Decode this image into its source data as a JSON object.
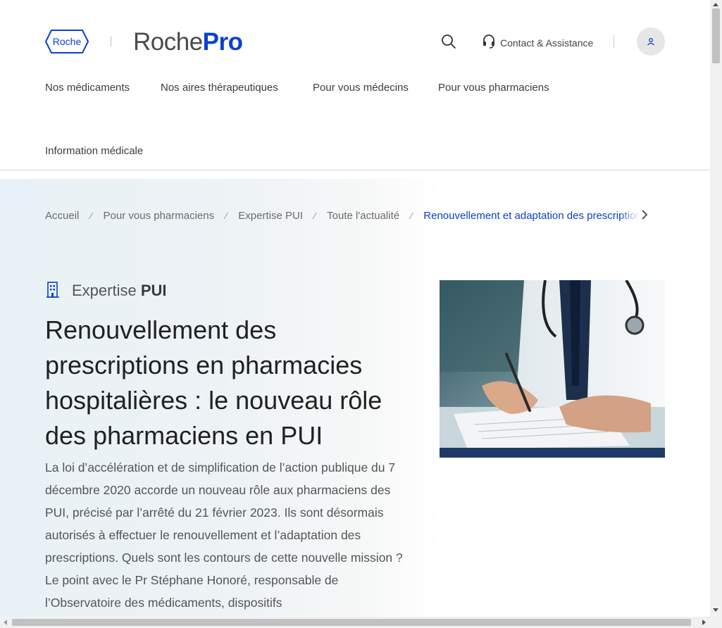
{
  "header": {
    "logo_text": "Roche",
    "brand_main": "Roche",
    "brand_accent": "Pro",
    "contact_label": "Contact & Assistance",
    "icons": [
      "search-icon",
      "headset-icon",
      "user-icon"
    ]
  },
  "nav": {
    "items": [
      "Nos médicaments",
      "Nos aires thérapeutiques",
      "Pour vous médecins",
      "Pour vous pharmaciens",
      "Information médicale"
    ]
  },
  "breadcrumb": {
    "items": [
      "Accueil",
      "Pour vous pharmaciens",
      "Expertise PUI",
      "Toute l'actualité"
    ],
    "separator": "⁄",
    "current": "Renouvellement et adaptation des prescriptions"
  },
  "article": {
    "category_prefix": "Expertise",
    "category_name": "PUI",
    "title": "Renouvellement des prescriptions en pharmacies hospitalières : le nouveau rôle des pharmaciens en PUI",
    "lead": "La loi d’accélération et de simplification de l’action publique du 7 décembre 2020 accorde un nouveau rôle aux pharmaciens des PUI, précisé par l’arrêté du 21 février 2023. Ils sont désormais autorisés à effectuer le renouvellement et l’adaptation des prescriptions. Quels sont les contours de cette nouvelle mission ? Le point avec le Pr Stéphane Honoré, responsable de l’Observatoire des médicaments, dispositifs"
  },
  "colors": {
    "brand_blue": "#0b41cd",
    "text_dark": "#212121",
    "text_muted": "#555555"
  }
}
